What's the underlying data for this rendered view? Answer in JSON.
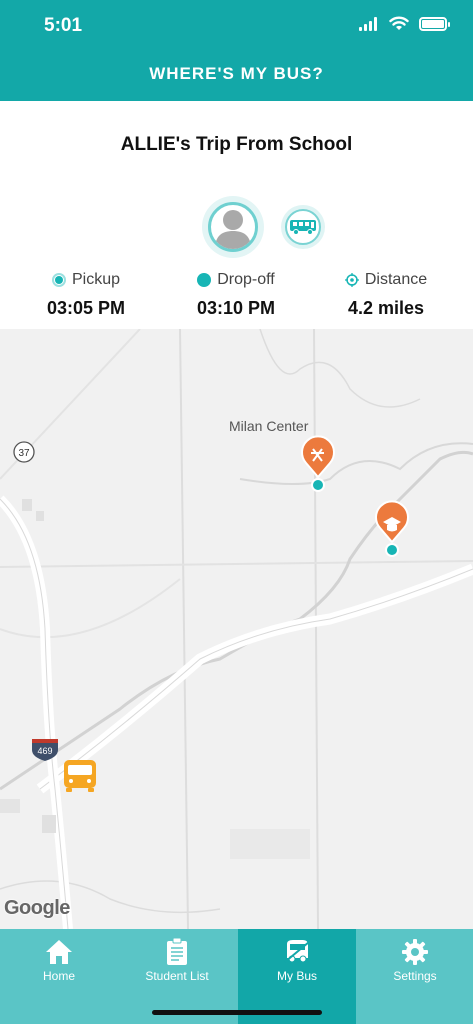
{
  "status_bar": {
    "time": "5:01"
  },
  "header": {
    "title": "WHERE'S MY BUS?"
  },
  "trip": {
    "title": "ALLIE's Trip From School"
  },
  "stats": {
    "pickup": {
      "label": "Pickup",
      "value": "03:05 PM"
    },
    "dropoff": {
      "label": "Drop-off",
      "value": "03:10 PM"
    },
    "distance": {
      "label": "Distance",
      "value": "4.2 miles"
    }
  },
  "map": {
    "place_label": "Milan Center",
    "route_shields": [
      "37",
      "469"
    ],
    "attribution": "Google"
  },
  "tabs": [
    {
      "label": "Home",
      "icon": "home-icon"
    },
    {
      "label": "Student List",
      "icon": "clipboard-icon"
    },
    {
      "label": "My Bus",
      "icon": "bus-icon",
      "active": true
    },
    {
      "label": "Settings",
      "icon": "gear-icon"
    }
  ],
  "colors": {
    "brand": "#13a8a8",
    "tab_bar": "#5ac5c6",
    "marker": "#ec7a3d",
    "bus": "#f5a623"
  }
}
